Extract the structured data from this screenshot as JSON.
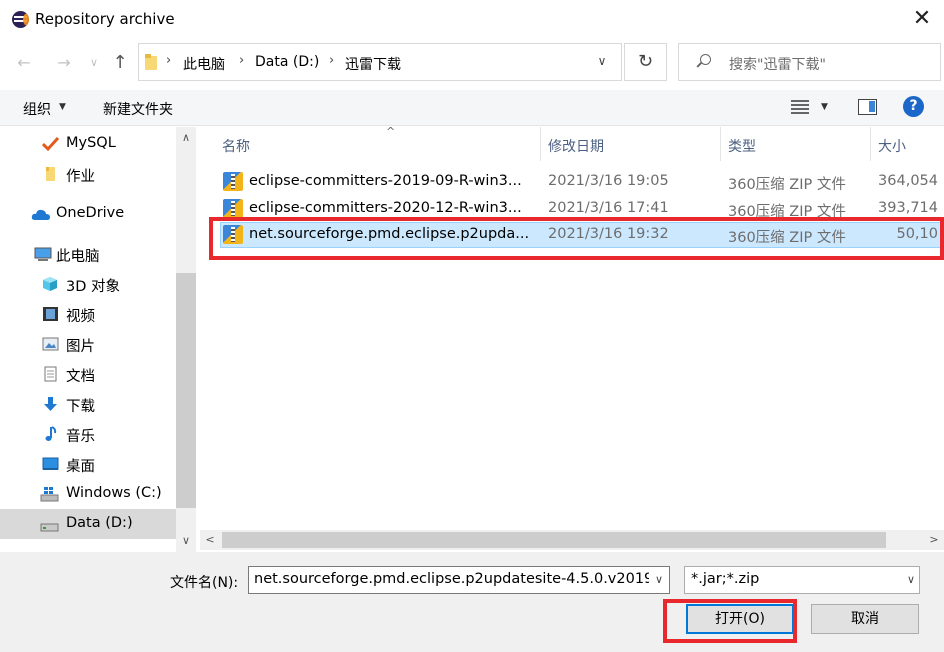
{
  "window": {
    "title": "Repository archive",
    "close_glyph": "✕"
  },
  "nav": {
    "back_glyph": "←",
    "forward_glyph": "→",
    "recent_glyph": "∨",
    "up_glyph": "↑",
    "refresh_glyph": "↻",
    "dropdown_glyph": "∨",
    "breadcrumb": [
      "此电脑",
      "Data (D:)",
      "迅雷下载"
    ],
    "breadcrumb_sep": "›",
    "search_placeholder": "搜索\"迅雷下载\""
  },
  "commands": {
    "organize": "组织",
    "organize_caret": "▼",
    "new_folder": "新建文件夹",
    "view_caret": "▼",
    "help": "?"
  },
  "sidebar": {
    "scroll_up": "∧",
    "scroll_down": "∨",
    "items": [
      {
        "label": "MySQL",
        "icon": "checkmark-icon"
      },
      {
        "label": "作业",
        "icon": "folder-icon"
      },
      {
        "label": "OneDrive",
        "icon": "cloud-icon"
      },
      {
        "label": "此电脑",
        "icon": "computer-icon"
      },
      {
        "label": "3D 对象",
        "icon": "cube-icon"
      },
      {
        "label": "视频",
        "icon": "film-icon"
      },
      {
        "label": "图片",
        "icon": "picture-icon"
      },
      {
        "label": "文档",
        "icon": "document-icon"
      },
      {
        "label": "下载",
        "icon": "download-icon"
      },
      {
        "label": "音乐",
        "icon": "music-icon"
      },
      {
        "label": "桌面",
        "icon": "desktop-icon"
      },
      {
        "label": "Windows (C:)",
        "icon": "system-drive-icon"
      },
      {
        "label": "Data (D:)",
        "icon": "drive-icon",
        "selected": true
      }
    ]
  },
  "filelist": {
    "columns": {
      "name": "名称",
      "date": "修改日期",
      "type": "类型",
      "size": "大小"
    },
    "sort_glyph": "^",
    "rows": [
      {
        "name": "eclipse-committers-2019-09-R-win3...",
        "date": "2021/3/16 19:05",
        "type": "360压缩 ZIP 文件",
        "size": "364,054",
        "selected": false
      },
      {
        "name": "eclipse-committers-2020-12-R-win3...",
        "date": "2021/3/16 17:41",
        "type": "360压缩 ZIP 文件",
        "size": "393,714",
        "selected": false
      },
      {
        "name": "net.sourceforge.pmd.eclipse.p2upda...",
        "date": "2021/3/16 19:32",
        "type": "360压缩 ZIP 文件",
        "size": "50,10",
        "selected": true
      }
    ],
    "hscroll_left": "<",
    "hscroll_right": ">"
  },
  "footer": {
    "filename_label": "文件名(N):",
    "filename_value": "net.sourceforge.pmd.eclipse.p2updatesite-4.5.0.v2019",
    "filename_drop": "∨",
    "filter_value": "*.jar;*.zip",
    "filter_drop": "∨",
    "open_label": "打开(O)",
    "cancel_label": "取消"
  },
  "colors": {
    "selection_bg": "#cce8ff",
    "annotation_red": "#e8282c",
    "accent_blue": "#0078d7"
  }
}
